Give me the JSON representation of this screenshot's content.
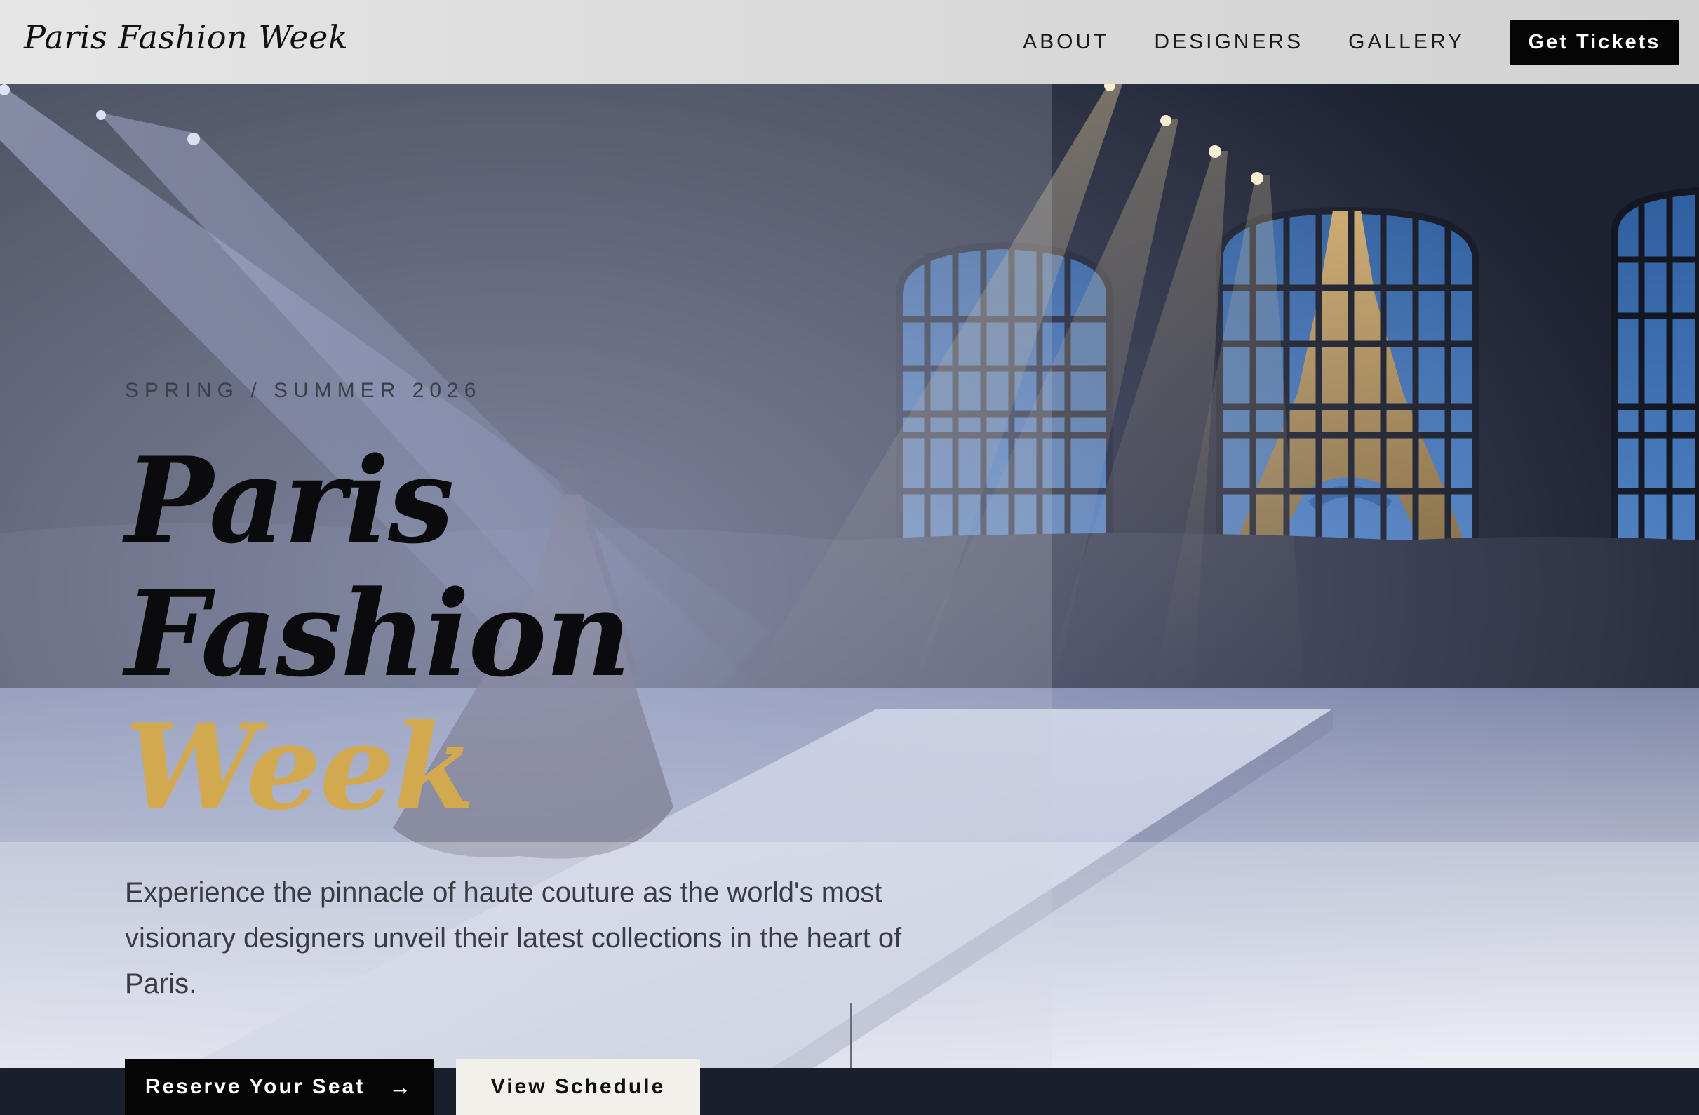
{
  "nav": {
    "brand": "Paris Fashion Week",
    "links": [
      "ABOUT",
      "DESIGNERS",
      "GALLERY"
    ],
    "cta": "Get Tickets"
  },
  "hero": {
    "eyebrow": "SPRING / SUMMER 2026",
    "title_line1": "Paris Fashion",
    "title_line2": "Week",
    "description": "Experience the pinnacle of haute couture as the world's most visionary designers unveil their latest collections in the heart of Paris.",
    "primary_button": "Reserve Your Seat",
    "primary_button_icon": "arrow-right-icon",
    "secondary_button": "View Schedule"
  },
  "colors": {
    "accent_gold": "#d2a94f",
    "cta_black": "#050505",
    "secondary_bg": "#f1f0ea"
  }
}
